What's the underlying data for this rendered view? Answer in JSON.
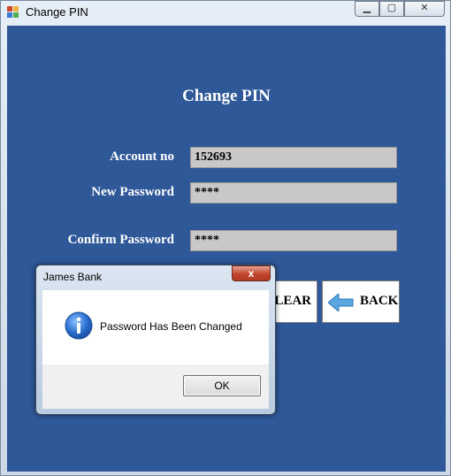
{
  "window": {
    "title": "Change PIN",
    "controls": {
      "minimize": "▭",
      "maximize": "▢",
      "close": "✕"
    }
  },
  "form": {
    "heading": "Change PIN",
    "account_label": "Account no",
    "account_value": "152693",
    "new_password_label": "New Password",
    "new_password_value": "****",
    "confirm_password_label": "Confirm Password",
    "confirm_password_value": "****",
    "clear_label": "CLEAR",
    "back_label": "BACK",
    "back_icon": "left-arrow-icon"
  },
  "dialog": {
    "title": "James Bank",
    "close_glyph": "x",
    "message": "Password Has Been Changed",
    "icon": "info-icon",
    "ok_label": "OK"
  },
  "colors": {
    "form_background": "#2e5898",
    "field_background": "#c8c8c8",
    "arrow": "#5aa7e0"
  }
}
